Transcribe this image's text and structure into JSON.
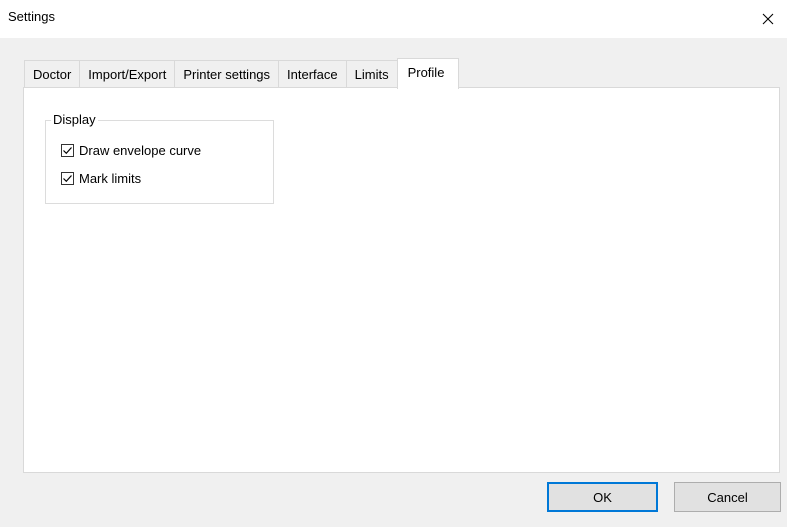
{
  "window": {
    "title": "Settings"
  },
  "icons": {
    "close": "close-icon",
    "checkmark": "checkmark-icon"
  },
  "tabs": [
    {
      "label": "Doctor",
      "active": false
    },
    {
      "label": "Import/Export",
      "active": false
    },
    {
      "label": "Printer settings",
      "active": false
    },
    {
      "label": "Interface",
      "active": false
    },
    {
      "label": "Limits",
      "active": false
    },
    {
      "label": "Profile",
      "active": true
    }
  ],
  "profile": {
    "display_group": {
      "label": "Display",
      "options": [
        {
          "label": "Draw envelope curve",
          "checked": true
        },
        {
          "label": "Mark limits",
          "checked": true
        }
      ]
    }
  },
  "buttons": {
    "ok_label": "OK",
    "cancel_label": "Cancel"
  },
  "colors": {
    "accent": "#0078d7",
    "panel_background": "#ffffff",
    "window_background": "#f0f0f0"
  }
}
